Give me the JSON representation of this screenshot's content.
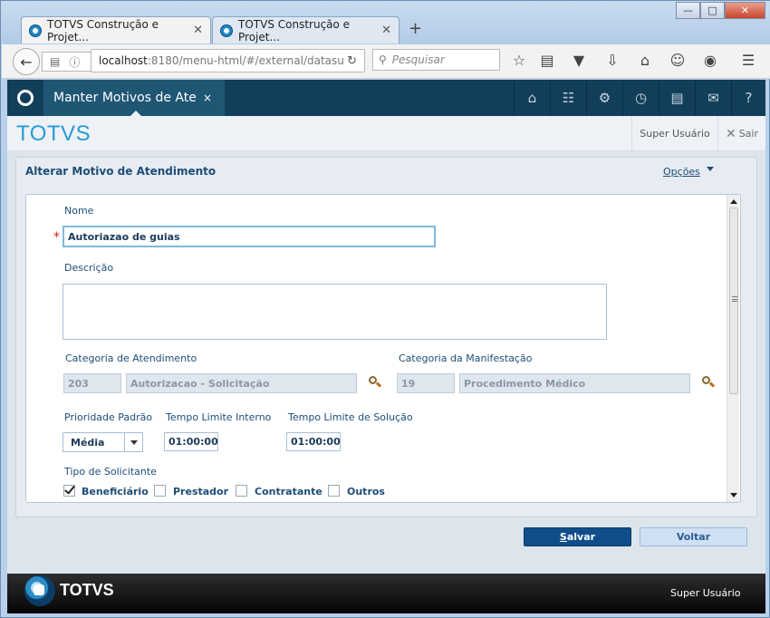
{
  "browser": {
    "tabs": [
      {
        "title": "TOTVS Construção e Projet...",
        "close": "✕"
      },
      {
        "title": "TOTVS Construção e Projet...",
        "close": "✕"
      }
    ],
    "new_tab": "+",
    "window_controls": {
      "minimize": "—",
      "maximize": "□",
      "close": "✕"
    },
    "url": {
      "host": "localhost",
      "path": ":8180/menu-html/#/external/datasu"
    },
    "search_placeholder": "Pesquisar"
  },
  "app": {
    "tab_title": "Manter Motivos de Ate",
    "tab_close": "×",
    "brand": "TOTVS",
    "user": "Super Usuário",
    "logout": "Sair"
  },
  "panel": {
    "title": "Alterar Motivo de Atendimento",
    "options": "Opções"
  },
  "form": {
    "nome_label": "Nome",
    "nome_required": "*",
    "nome_value": "Autoriazao de guias",
    "descricao_label": "Descrição",
    "descricao_value": "",
    "cat_atendimento_label": "Categoria de Atendimento",
    "cat_atendimento_code": "203",
    "cat_atendimento_desc": "Autorizacao - Solicitação",
    "cat_manifestacao_label": "Categoria da Manifestação",
    "cat_manifestacao_code": "19",
    "cat_manifestacao_desc": "Procedimento Médico",
    "prioridade_label": "Prioridade Padrão",
    "prioridade_value": "Média",
    "tempo_atend_label": "Tempo Limite Interno",
    "tempo_atend_value": "01:00:00",
    "tempo_solucao_label": "Tempo Limite de Solução",
    "tempo_solucao_value": "01:00:00",
    "tipo_solicitante_label": "Tipo de Solicitante",
    "solicitantes": [
      {
        "label": "Beneficiário",
        "checked": true
      },
      {
        "label": "Prestador",
        "checked": false
      },
      {
        "label": "Contratante",
        "checked": false
      },
      {
        "label": "Outros",
        "checked": false
      }
    ]
  },
  "actions": {
    "save_hotkey": "S",
    "save_rest": "alvar",
    "back": "Voltar"
  },
  "footer": {
    "brand": "TOTVS",
    "user": "Super Usuário"
  }
}
